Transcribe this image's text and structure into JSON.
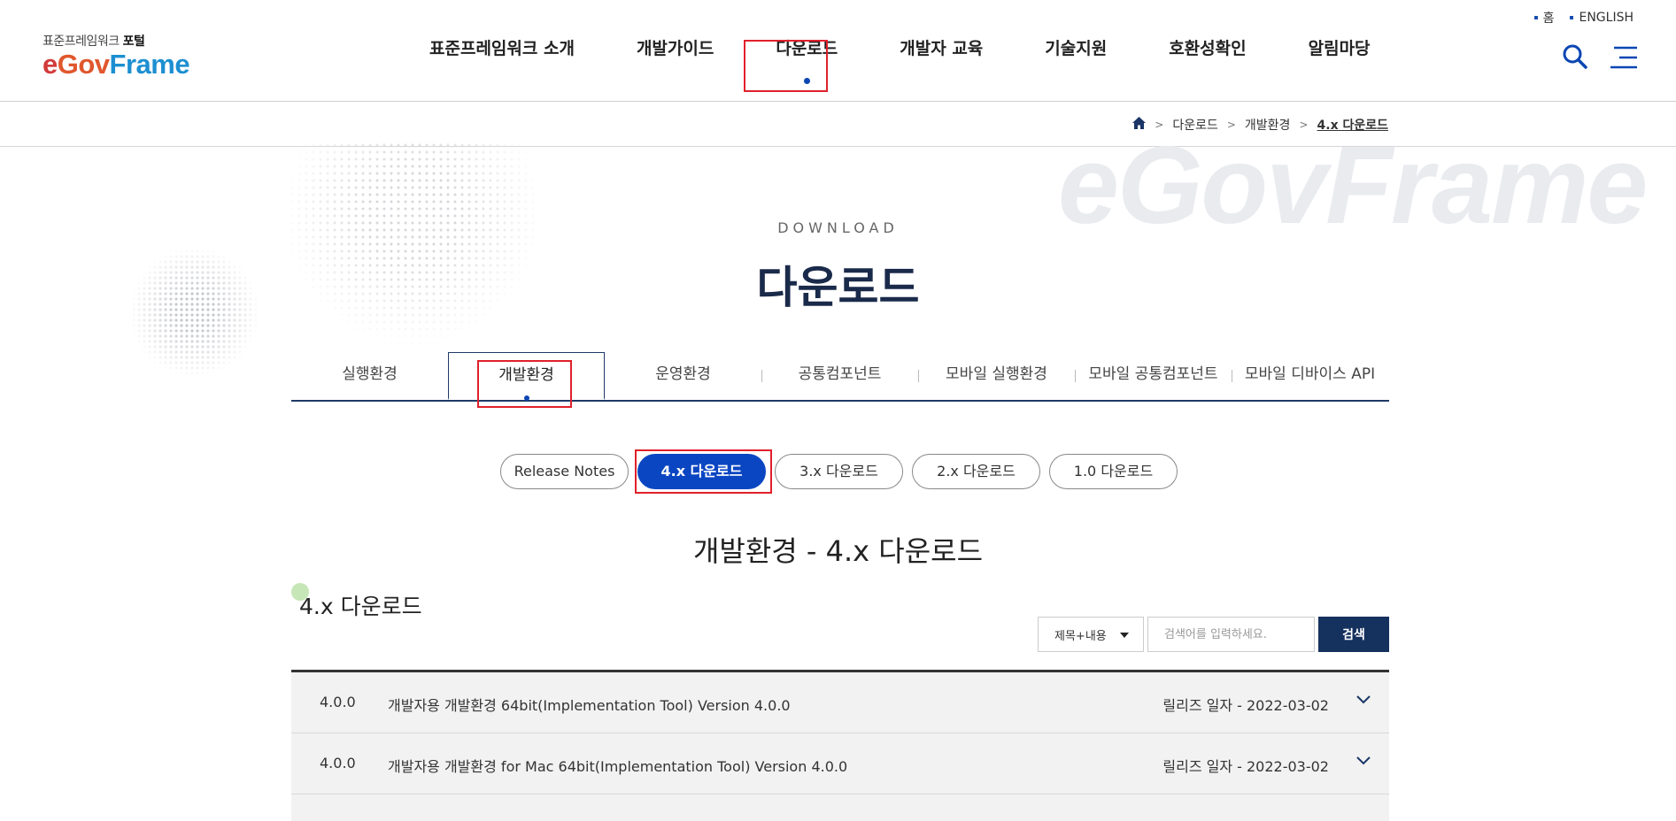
{
  "util": {
    "home": "홈",
    "english": "ENGLISH"
  },
  "logo": {
    "top_text": "표준프레임워크",
    "top_bold": "포털",
    "e": "e",
    "gov": "Gov",
    "frame": "Frame"
  },
  "gnb": [
    {
      "label": "표준프레임워크 소개"
    },
    {
      "label": "개발가이드"
    },
    {
      "label": "다운로드"
    },
    {
      "label": "개발자 교육"
    },
    {
      "label": "기술지원"
    },
    {
      "label": "호환성확인"
    },
    {
      "label": "알림마당"
    }
  ],
  "gnb_active_index": 2,
  "icons": {
    "search": "search-icon",
    "menu": "hamburger-menu-icon",
    "home": "home-icon"
  },
  "breadcrumb": {
    "items": [
      "다운로드",
      "개발환경"
    ],
    "current": "4.x 다운로드"
  },
  "hero": {
    "eyebrow": "DOWNLOAD",
    "title": "다운로드",
    "watermark": "eGovFrame"
  },
  "subtabs": [
    {
      "label": "실행환경"
    },
    {
      "label": "개발환경"
    },
    {
      "label": "운영환경"
    },
    {
      "label": "공통컴포넌트"
    },
    {
      "label": "모바일 실행환경"
    },
    {
      "label": "모바일 공통컴포넌트"
    },
    {
      "label": "모바일 디바이스 API"
    }
  ],
  "subtab_active_index": 1,
  "pills": [
    {
      "label": "Release Notes"
    },
    {
      "label": "4.x 다운로드"
    },
    {
      "label": "3.x 다운로드"
    },
    {
      "label": "2.x 다운로드"
    },
    {
      "label": "1.0 다운로드"
    }
  ],
  "pill_active_index": 1,
  "section": {
    "title": "개발환경 - 4.x 다운로드",
    "sub_heading": "4.x 다운로드"
  },
  "search": {
    "select_value": "제목+내용",
    "placeholder": "검색어를 입력하세요.",
    "button": "검색"
  },
  "rows": [
    {
      "version": "4.0.0",
      "title": "개발자용 개발환경 64bit(Implementation Tool) Version 4.0.0",
      "date": "릴리즈 일자 - 2022-03-02"
    },
    {
      "version": "4.0.0",
      "title": "개발자용 개발환경 for Mac 64bit(Implementation Tool) Version 4.0.0",
      "date": "릴리즈 일자 - 2022-03-02"
    }
  ],
  "colors": {
    "primary": "#0b46c2",
    "navy": "#15315e",
    "highlight": "#e0202a"
  }
}
